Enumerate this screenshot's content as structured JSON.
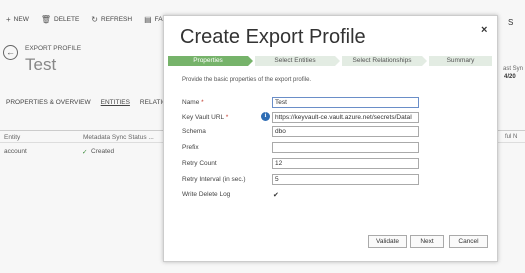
{
  "background": {
    "commands": [
      {
        "icon": "plus-icon",
        "glyph": "+",
        "label": "NEW"
      },
      {
        "icon": "trash-icon",
        "glyph": "🗑",
        "label": "DELETE"
      },
      {
        "icon": "refresh-icon",
        "glyph": "↻",
        "label": "REFRESH"
      },
      {
        "icon": "failed-icon",
        "glyph": "▤",
        "label": "FAILED"
      }
    ],
    "back_glyph": "←",
    "breadcrumb": "EXPORT PROFILE",
    "record_title": "Test",
    "tabs": [
      "PROPERTIES & OVERVIEW",
      "ENTITIES",
      "RELATIONS"
    ],
    "grid_headers": [
      "Entity",
      "Metadata Sync Status ..."
    ],
    "grid_row": {
      "entity": "account",
      "status_icon": "created-icon",
      "status": "Created"
    },
    "right_fragments": [
      "S",
      "ast Syn",
      "4/20",
      "ful N"
    ]
  },
  "dialog": {
    "title": "Create Export Profile",
    "close_glyph": "×",
    "steps": [
      {
        "label": "Properties",
        "active": true
      },
      {
        "label": "Select Entities",
        "active": false
      },
      {
        "label": "Select Relationships",
        "active": false
      },
      {
        "label": "Summary",
        "active": false
      }
    ],
    "intro": "Provide the basic properties of the export profile.",
    "fields": {
      "name": {
        "label": "Name",
        "required": "*",
        "value": "Test"
      },
      "keyvault": {
        "label": "Key Vault URL",
        "required": "*",
        "info_glyph": "i",
        "value": "https://keyvault-ce.vault.azure.net/secrets/DataI"
      },
      "schema": {
        "label": "Schema",
        "value": "dbo"
      },
      "prefix": {
        "label": "Prefix",
        "value": ""
      },
      "retry_count": {
        "label": "Retry Count",
        "value": "12"
      },
      "retry_interval": {
        "label": "Retry Interval (in sec.)",
        "value": "5"
      },
      "write_delete_log": {
        "label": "Write Delete Log",
        "checked": true,
        "check_glyph": "✔"
      }
    },
    "buttons": {
      "validate": "Validate",
      "next": "Next",
      "cancel": "Cancel"
    }
  }
}
